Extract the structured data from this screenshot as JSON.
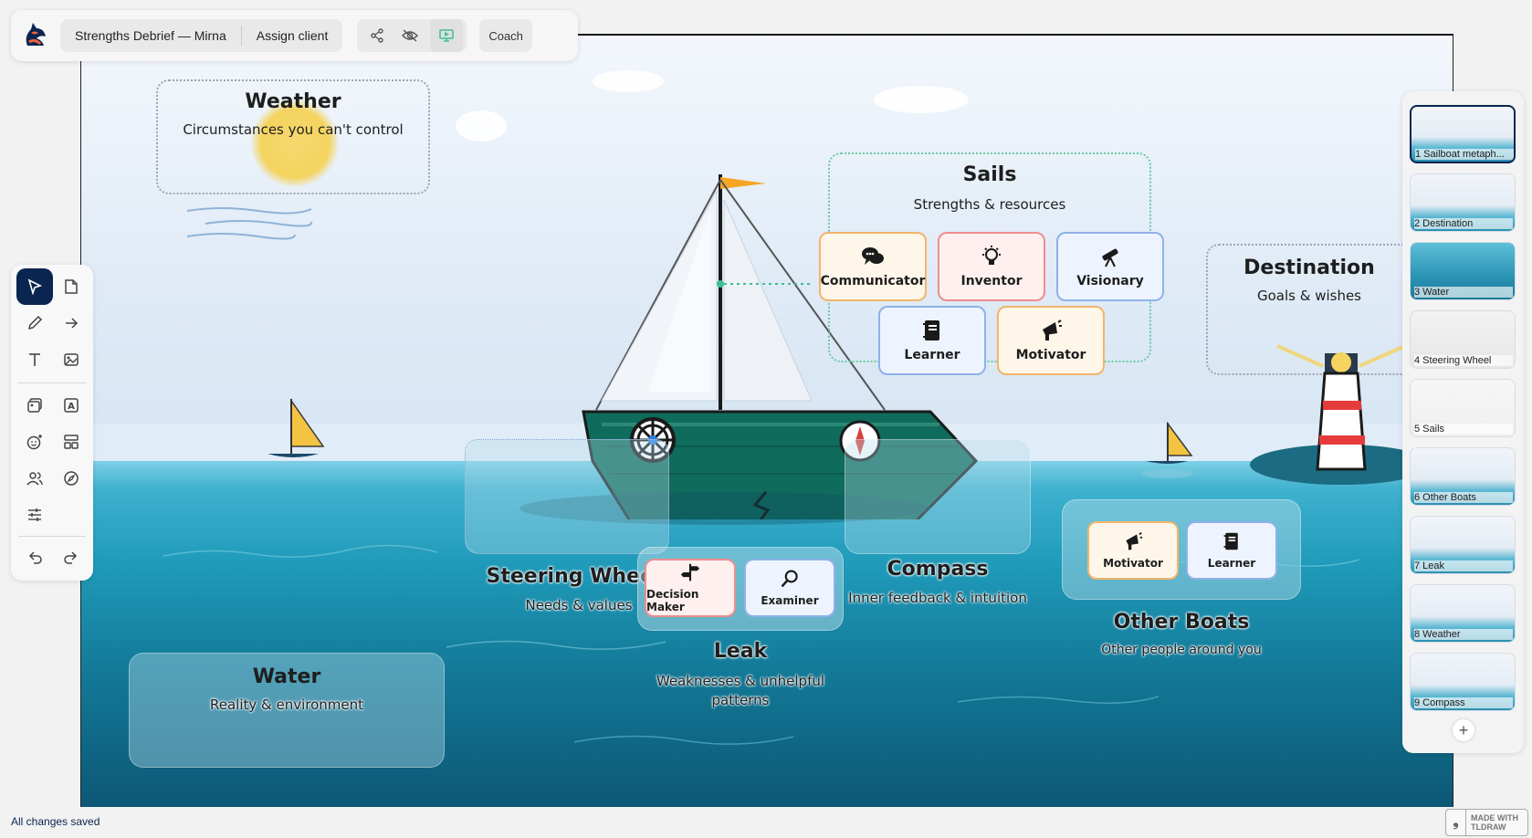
{
  "topbar": {
    "board_title": "Strengths Debrief — Mirna",
    "assign_label": "Assign client",
    "coach_label": "Coach",
    "icons": [
      "share-icon",
      "hide-icon",
      "present-icon"
    ]
  },
  "toolbar": {
    "tools": [
      "select",
      "note",
      "draw",
      "arrow",
      "text",
      "image-upload",
      "media",
      "asset",
      "emoji",
      "layout",
      "people",
      "compass",
      "settings",
      "undo",
      "redo"
    ],
    "active_tool": "select"
  },
  "canvas": {
    "weather": {
      "title": "Weather",
      "subtitle": "Circumstances you can't control"
    },
    "sails": {
      "title": "Sails",
      "subtitle": "Strengths & resources"
    },
    "destination": {
      "title": "Destination",
      "subtitle": "Goals & wishes"
    },
    "steering": {
      "title": "Steering Wheel",
      "subtitle": "Needs & values"
    },
    "compass": {
      "title": "Compass",
      "subtitle": "Inner feedback & intuition"
    },
    "leak": {
      "title": "Leak",
      "subtitle_line1": "Weaknesses & unhelpful",
      "subtitle_line2": "patterns"
    },
    "other_boats": {
      "title": "Other Boats",
      "subtitle": "Other people around you"
    },
    "water": {
      "title": "Water",
      "subtitle": "Reality & environment"
    },
    "sail_cards": [
      {
        "label": "Communicator",
        "icon": "speech-bubbles-icon",
        "color": "orange"
      },
      {
        "label": "Inventor",
        "icon": "lightbulb-icon",
        "color": "red"
      },
      {
        "label": "Visionary",
        "icon": "telescope-icon",
        "color": "blue"
      },
      {
        "label": "Learner",
        "icon": "notebook-icon",
        "color": "blue"
      },
      {
        "label": "Motivator",
        "icon": "megaphone-icon",
        "color": "orange"
      }
    ],
    "leak_cards": [
      {
        "label": "Decision Maker",
        "icon": "signpost-icon",
        "color": "red"
      },
      {
        "label": "Examiner",
        "icon": "magnifier-icon",
        "color": "blue"
      }
    ],
    "other_boat_cards": [
      {
        "label": "Motivator",
        "icon": "megaphone-icon",
        "color": "orange"
      },
      {
        "label": "Learner",
        "icon": "notebook-icon",
        "color": "blue"
      }
    ]
  },
  "pages": [
    {
      "label": "1 Sailboat metaph..."
    },
    {
      "label": "2 Destination"
    },
    {
      "label": "3 Water"
    },
    {
      "label": "4 Steering Wheel"
    },
    {
      "label": "5 Sails"
    },
    {
      "label": "6 Other Boats"
    },
    {
      "label": "7 Leak"
    },
    {
      "label": "8 Weather"
    },
    {
      "label": "9 Compass"
    }
  ],
  "add_page_label": "+",
  "status": "All changes saved",
  "watermark": {
    "line1": "MADE WITH",
    "line2": "TLDRAW"
  },
  "colors": {
    "accent": "#0b2551",
    "boat": "#0f6b5c",
    "sea": "#1f9ab9",
    "sun": "#f4d35e"
  }
}
